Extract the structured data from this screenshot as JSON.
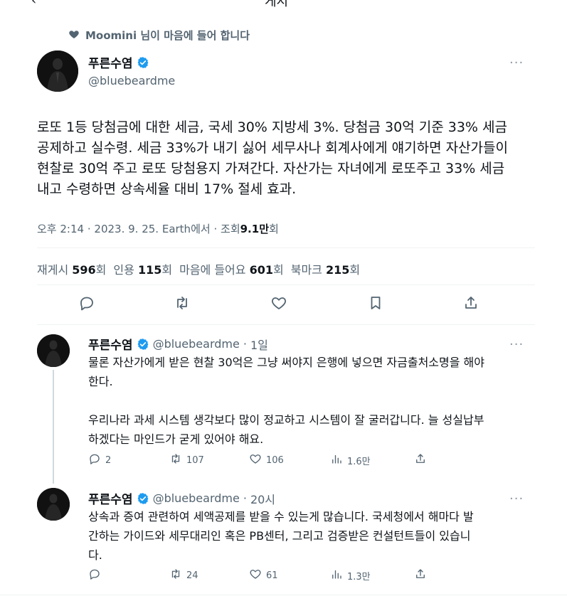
{
  "topbar": {
    "back_glyph": "‹",
    "title_fragment": "게시"
  },
  "social_context": {
    "icon": "heart-icon",
    "text": "Moomini 님이 마음에 들어 합니다"
  },
  "main_tweet": {
    "author": {
      "name": "푸른수염",
      "handle": "@bluebeardme",
      "verified": true
    },
    "more_glyph": "···",
    "text": "로또 1등 당첨금에 대한 세금, 국세 30% 지방세 3%. 당첨금 30억 기준 33% 세금\n공제하고 실수령. 세금 33%가 내기 싫어 세무사나 회계사에게 얘기하면 자산가들이\n현찰로 30억 주고 로또 당첨용지 가져간다. 자산가는 자녀에게 로또주고 33% 세금\n내고 수령하면 상속세율 대비 17% 절세 효과.",
    "meta": {
      "time": "오후 2:14",
      "date": "2023. 9. 25.",
      "source": "Earth에서",
      "views_label": "조회",
      "views_value": "9.1만",
      "views_unit": "회",
      "sep": "·"
    },
    "stats": [
      {
        "label": "재게시",
        "value": "596",
        "unit": "회"
      },
      {
        "label": "인용",
        "value": "115",
        "unit": "회"
      },
      {
        "label": "마음에 들어요",
        "value": "601",
        "unit": "회"
      },
      {
        "label": "북마크",
        "value": "215",
        "unit": "회"
      }
    ]
  },
  "replies": [
    {
      "author": {
        "name": "푸른수염",
        "handle": "@bluebeardme",
        "verified": true
      },
      "time_ago": "1일",
      "sep": "·",
      "more_glyph": "···",
      "text": "물론 자산가에게 받은 현찰 30억은 그냥 써야지 은행에 넣으면 자금출처소명을 해야\n한다.\n\n우리나라 과세 시스템 생각보다 많이 정교하고 시스템이 잘 굴러갑니다. 늘 성실납부\n하겠다는 마인드가 굳게 있어야 해요.",
      "counts": {
        "replies": "2",
        "reposts": "107",
        "likes": "106",
        "views": "1.6만"
      }
    },
    {
      "author": {
        "name": "푸른수염",
        "handle": "@bluebeardme",
        "verified": true
      },
      "time_ago": "20시",
      "sep": "·",
      "more_glyph": "···",
      "text": "상속과 증여 관련하여 세액공제를 받을 수 있는게 많습니다. 국세청에서 해마다 발\n간하는 가이드와 세무대리인 혹은 PB센터, 그리고 검증받은 컨설턴트들이 있습니\n다.",
      "counts": {
        "replies": "",
        "reposts": "24",
        "likes": "61",
        "views": "1.3만"
      }
    }
  ],
  "colors": {
    "verified": "#1d9bf0",
    "text": "#0f1419",
    "muted": "#536471",
    "divider": "#eff3f4"
  }
}
